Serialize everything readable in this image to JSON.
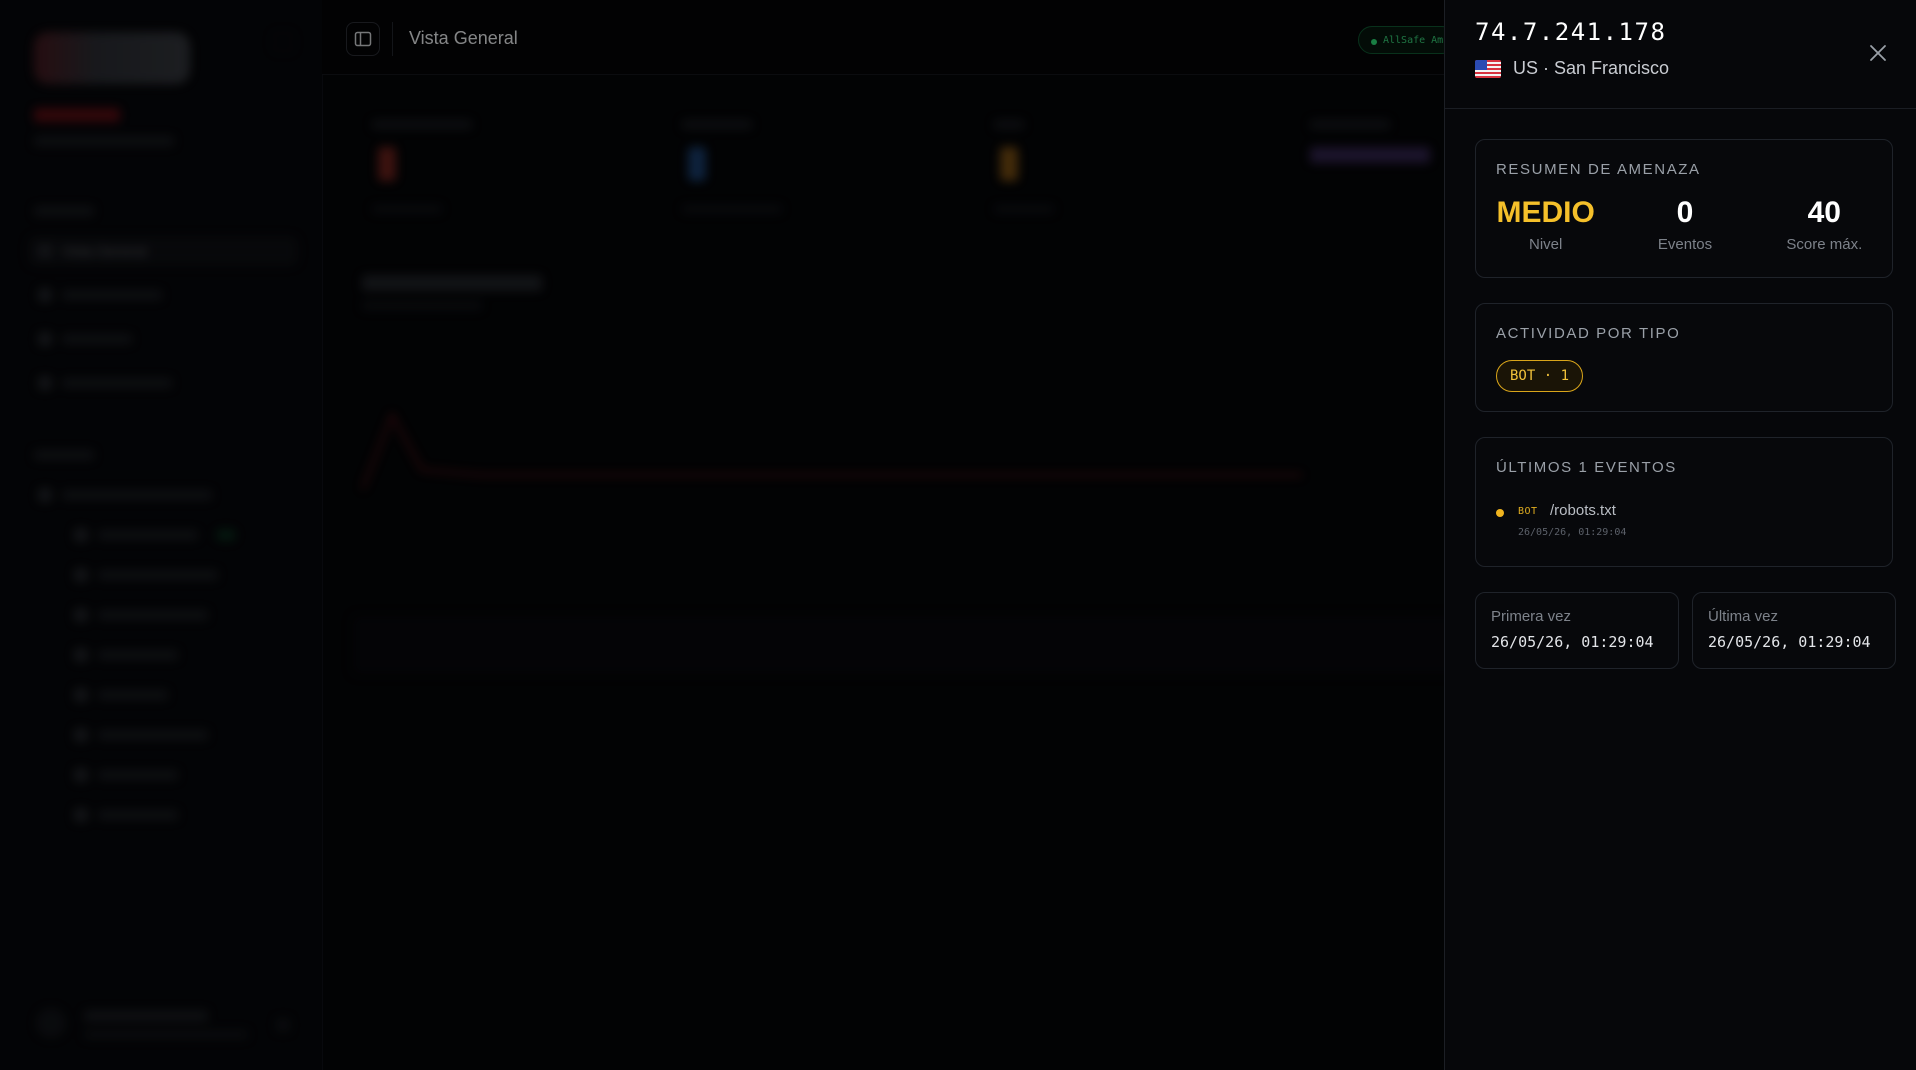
{
  "header": {
    "title": "Vista General",
    "status_pill": "AllSafe Am"
  },
  "sidebar": {
    "items": [
      {
        "label": "Vista General",
        "active": true
      },
      {
        "label": "",
        "active": false
      },
      {
        "label": "",
        "active": false
      },
      {
        "label": "",
        "active": false
      }
    ]
  },
  "drawer": {
    "ip": "74.7.241.178",
    "country_code": "US",
    "location": "US · San Francisco",
    "threat_summary": {
      "title": "RESUMEN DE AMENAZA",
      "level_value": "MEDIO",
      "level_label": "Nivel",
      "events_value": "0",
      "events_label": "Eventos",
      "score_value": "40",
      "score_label": "Score máx."
    },
    "activity": {
      "title": "ACTIVIDAD POR TIPO",
      "chip": "BOT · 1"
    },
    "recent_events": {
      "title": "ÚLTIMOS 1 EVENTOS",
      "items": [
        {
          "type": "BOT",
          "path": "/robots.txt",
          "time": "26/05/26, 01:29:04"
        }
      ]
    },
    "first_seen": {
      "label": "Primera vez",
      "value": "26/05/26, 01:29:04"
    },
    "last_seen": {
      "label": "Última vez",
      "value": "26/05/26, 01:29:04"
    }
  },
  "colors": {
    "accent_warning": "#f5c02a",
    "status_green": "#39d47a",
    "background": "#050608"
  }
}
